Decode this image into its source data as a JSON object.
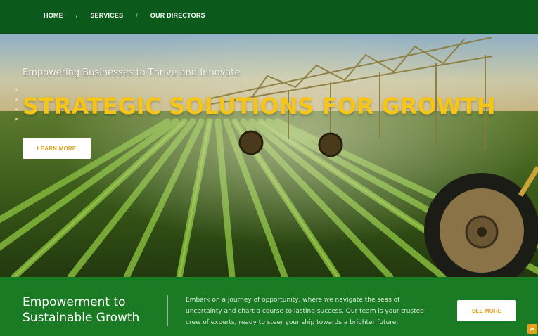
{
  "nav": {
    "items": [
      {
        "label": "HOME"
      },
      {
        "label": "SERVICES"
      },
      {
        "label": "OUR DIRECTORS"
      }
    ],
    "separator": "/"
  },
  "hero": {
    "subtitle": "Empowering Businesses to Thrive and Innovate",
    "title": "STRATEGIC SOLUTIONS FOR GROWTH",
    "cta_label": "LEARN MORE",
    "image": "agricultural-field-irrigation-image"
  },
  "band": {
    "heading_line1": "Empowerment to",
    "heading_line2": "Sustainable Growth",
    "text": "Embark on a journey of opportunity, where we navigate the seas of uncertainty and chart a course to lasting success. Our team is your trusted crew of experts, ready to steer your ship towards a brighter future.",
    "cta_label": "SEE MORE"
  },
  "colors": {
    "nav_bg": "#0b5a1c",
    "band_bg": "#1b7a24",
    "accent": "#f5c518",
    "button_text": "#e3a21a"
  },
  "icons": {
    "scroll_top": "chevron-up-icon"
  }
}
